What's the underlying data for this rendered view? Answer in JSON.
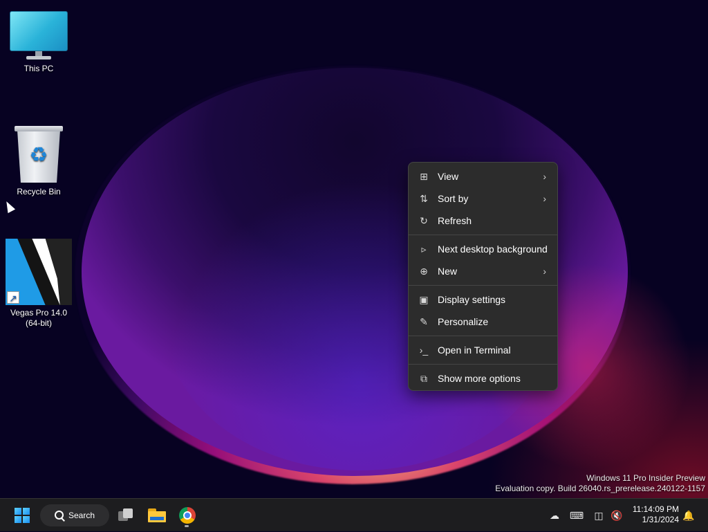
{
  "desktop": {
    "icons": [
      {
        "label": "This PC"
      },
      {
        "label": "Recycle Bin"
      },
      {
        "label_line1": "Vegas Pro 14.0",
        "label_line2": "(64-bit)"
      }
    ]
  },
  "context_menu": {
    "items": [
      {
        "label": "View",
        "icon": "grid-icon",
        "submenu": true
      },
      {
        "label": "Sort by",
        "icon": "sort-icon",
        "submenu": true
      },
      {
        "label": "Refresh",
        "icon": "refresh-icon",
        "submenu": false
      },
      {
        "label": "Next desktop background",
        "icon": "next-background-icon",
        "submenu": false
      },
      {
        "label": "New",
        "icon": "plus-circle-icon",
        "submenu": true
      },
      {
        "label": "Display settings",
        "icon": "display-settings-icon",
        "submenu": false
      },
      {
        "label": "Personalize",
        "icon": "pen-icon",
        "submenu": false
      },
      {
        "label": "Open in Terminal",
        "icon": "terminal-icon",
        "submenu": false
      },
      {
        "label": "Show more options",
        "icon": "more-options-icon",
        "submenu": false
      }
    ]
  },
  "watermark": {
    "line1": "Windows 11 Pro Insider Preview",
    "line2": "Evaluation copy. Build 26040.rs_prerelease.240122-1157"
  },
  "taskbar": {
    "search_label": "Search",
    "pinned": [
      "start-icon",
      "task-view-icon",
      "file-explorer-icon",
      "chrome-icon"
    ],
    "tray": [
      "onedrive-offline-icon",
      "keyboard-icon",
      "network-icon",
      "volume-muted-icon"
    ],
    "clock": {
      "time": "11:14:09 PM",
      "date": "1/31/2024"
    }
  },
  "colors": {
    "menu_bg": "#2c2c2c",
    "taskbar_bg": "#1d1d1f",
    "accent": "#1a8ef0"
  }
}
